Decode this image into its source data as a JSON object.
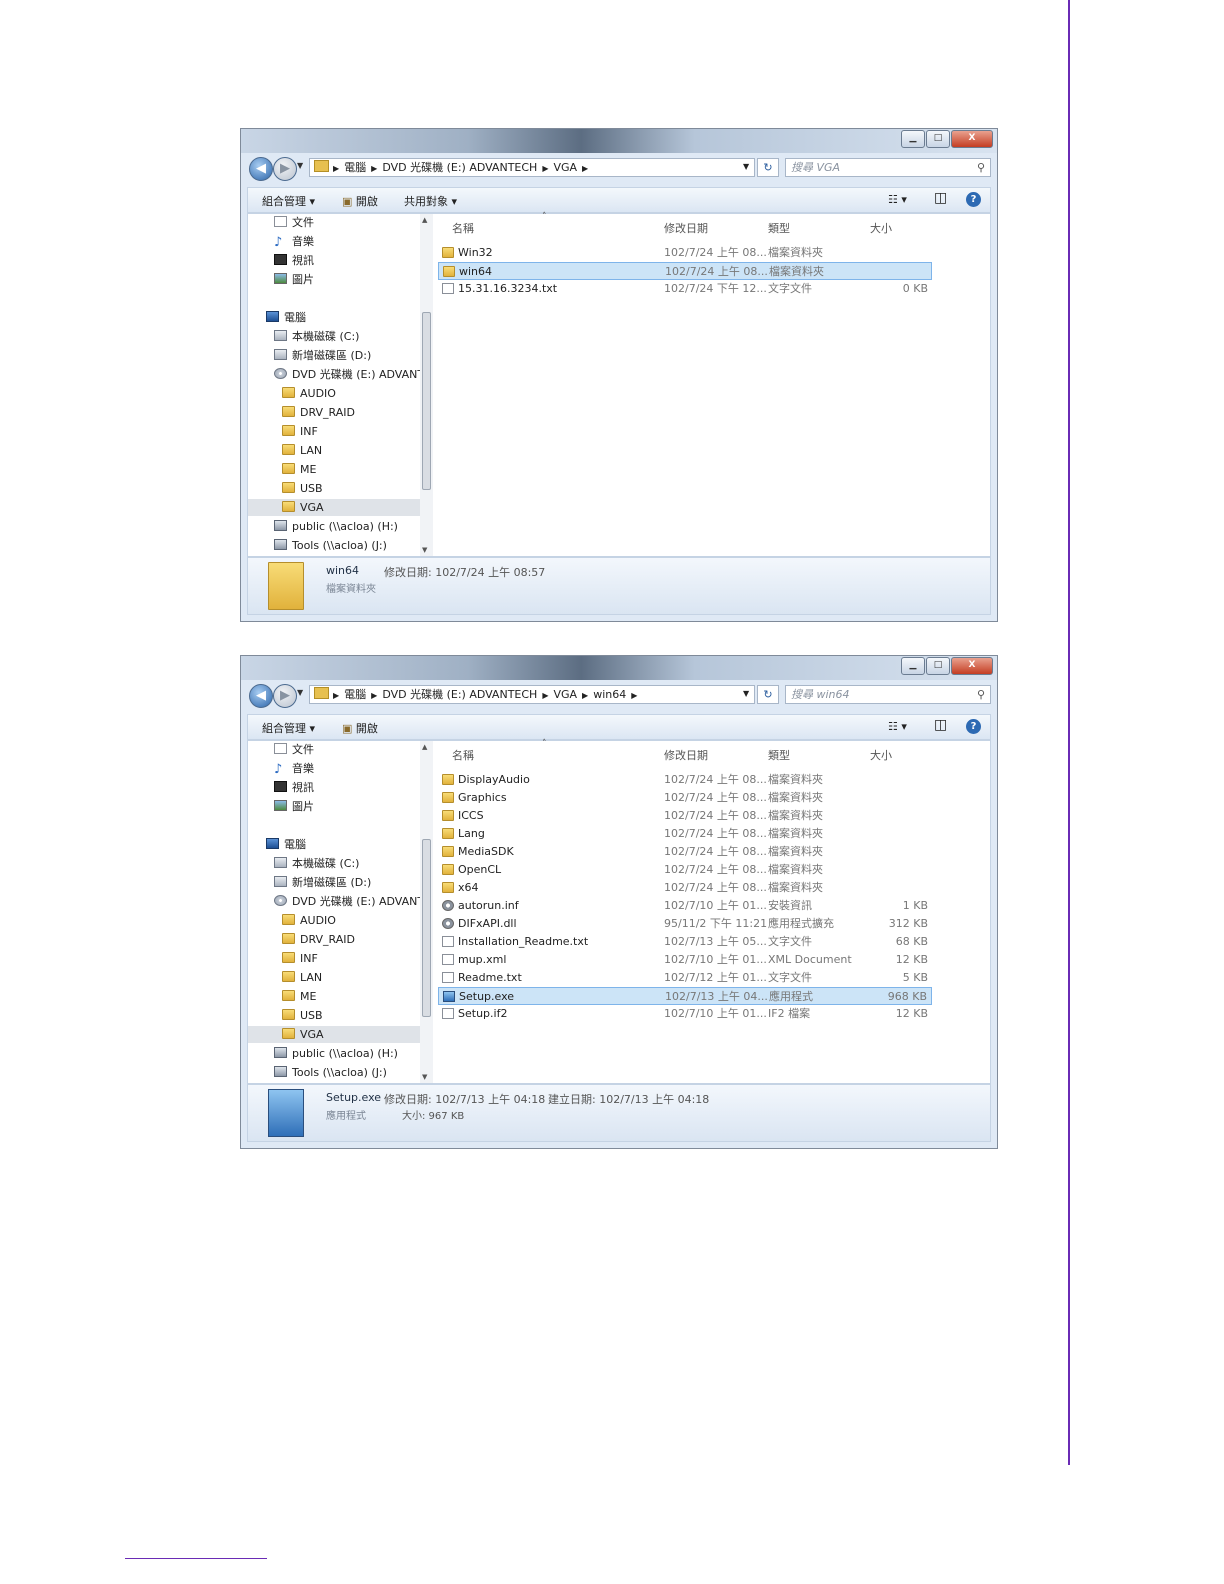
{
  "windows": [
    {
      "address": {
        "crumbs": [
          "電腦",
          "DVD 光碟機 (E:) ADVANTECH",
          "VGA"
        ]
      },
      "search_placeholder": "搜尋 VGA",
      "toolbar": {
        "organize": "組合管理 ▾",
        "open": "開啟",
        "share": "共用對象 ▾"
      },
      "nav": {
        "favorites": [
          "文件",
          "音樂",
          "視訊",
          "圖片"
        ],
        "computer": "電腦",
        "drives": [
          "本機磁碟 (C:)",
          "新增磁碟區 (D:)",
          "DVD 光碟機 (E:) ADVANTE"
        ],
        "folders": [
          "AUDIO",
          "DRV_RAID",
          "INF",
          "LAN",
          "ME",
          "USB",
          "VGA"
        ],
        "network": [
          "public (\\\\acloa) (H:)",
          "Tools (\\\\acloa) (J:)"
        ]
      },
      "columns": {
        "name": "名稱",
        "date": "修改日期",
        "type": "類型",
        "size": "大小"
      },
      "files": [
        {
          "name": "Win32",
          "date": "102/7/24 上午 08...",
          "type": "檔案資料夾",
          "size": "",
          "icon": "folder"
        },
        {
          "name": "win64",
          "date": "102/7/24 上午 08...",
          "type": "檔案資料夾",
          "size": "",
          "icon": "folder"
        },
        {
          "name": "15.31.16.3234.txt",
          "date": "102/7/24 下午 12...",
          "type": "文字文件",
          "size": "0 KB",
          "icon": "file"
        }
      ],
      "details": {
        "name": "win64",
        "sub": "檔案資料夾",
        "meta1": "修改日期: 102/7/24 上午 08:57",
        "meta2": "",
        "meta3": ""
      }
    },
    {
      "address": {
        "crumbs": [
          "電腦",
          "DVD 光碟機 (E:) ADVANTECH",
          "VGA",
          "win64"
        ]
      },
      "search_placeholder": "搜尋 win64",
      "toolbar": {
        "organize": "組合管理 ▾",
        "open": "開啟",
        "share": ""
      },
      "nav": {
        "favorites": [
          "文件",
          "音樂",
          "視訊",
          "圖片"
        ],
        "computer": "電腦",
        "drives": [
          "本機磁碟 (C:)",
          "新增磁碟區 (D:)",
          "DVD 光碟機 (E:) ADVANTE"
        ],
        "folders": [
          "AUDIO",
          "DRV_RAID",
          "INF",
          "LAN",
          "ME",
          "USB",
          "VGA"
        ],
        "network": [
          "public (\\\\acloa) (H:)",
          "Tools (\\\\acloa) (J:)"
        ]
      },
      "columns": {
        "name": "名稱",
        "date": "修改日期",
        "type": "類型",
        "size": "大小"
      },
      "files": [
        {
          "name": "DisplayAudio",
          "date": "102/7/24 上午 08...",
          "type": "檔案資料夾",
          "size": "",
          "icon": "folder"
        },
        {
          "name": "Graphics",
          "date": "102/7/24 上午 08...",
          "type": "檔案資料夾",
          "size": "",
          "icon": "folder"
        },
        {
          "name": "ICCS",
          "date": "102/7/24 上午 08...",
          "type": "檔案資料夾",
          "size": "",
          "icon": "folder"
        },
        {
          "name": "Lang",
          "date": "102/7/24 上午 08...",
          "type": "檔案資料夾",
          "size": "",
          "icon": "folder"
        },
        {
          "name": "MediaSDK",
          "date": "102/7/24 上午 08...",
          "type": "檔案資料夾",
          "size": "",
          "icon": "folder"
        },
        {
          "name": "OpenCL",
          "date": "102/7/24 上午 08...",
          "type": "檔案資料夾",
          "size": "",
          "icon": "folder"
        },
        {
          "name": "x64",
          "date": "102/7/24 上午 08...",
          "type": "檔案資料夾",
          "size": "",
          "icon": "folder"
        },
        {
          "name": "autorun.inf",
          "date": "102/7/10 上午 01...",
          "type": "安裝資訊",
          "size": "1 KB",
          "icon": "gear"
        },
        {
          "name": "DIFxAPI.dll",
          "date": "95/11/2 下午 11:21",
          "type": "應用程式擴充",
          "size": "312 KB",
          "icon": "gear"
        },
        {
          "name": "Installation_Readme.txt",
          "date": "102/7/13 上午 05...",
          "type": "文字文件",
          "size": "68 KB",
          "icon": "file"
        },
        {
          "name": "mup.xml",
          "date": "102/7/10 上午 01...",
          "type": "XML Document",
          "size": "12 KB",
          "icon": "file"
        },
        {
          "name": "Readme.txt",
          "date": "102/7/12 上午 01...",
          "type": "文字文件",
          "size": "5 KB",
          "icon": "file"
        },
        {
          "name": "Setup.exe",
          "date": "102/7/13 上午 04...",
          "type": "應用程式",
          "size": "968 KB",
          "icon": "exe"
        },
        {
          "name": "Setup.if2",
          "date": "102/7/10 上午 01...",
          "type": "IF2 檔案",
          "size": "12 KB",
          "icon": "file"
        }
      ],
      "details": {
        "name": "Setup.exe",
        "sub": "應用程式",
        "meta1": "修改日期: 102/7/13 上午 04:18",
        "meta2": "建立日期: 102/7/13 上午 04:18",
        "meta3": "大小: 967 KB"
      }
    }
  ],
  "colors": {
    "accent_line": "#6a2bb5",
    "selection": "#cce4f7"
  }
}
